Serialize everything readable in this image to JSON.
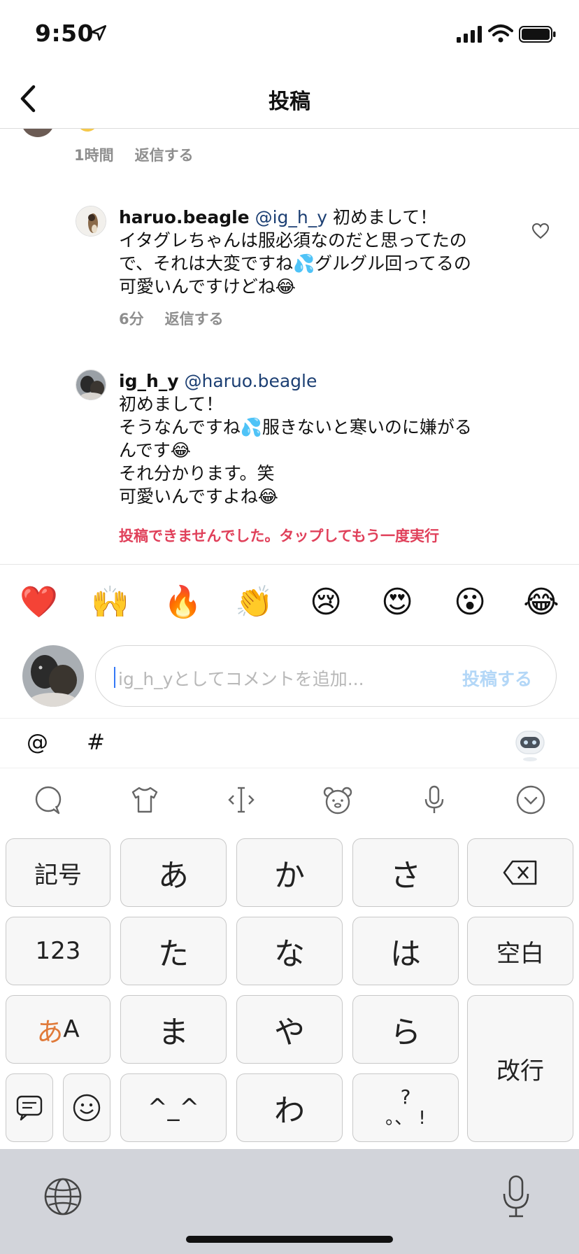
{
  "status_bar": {
    "time": "9:50"
  },
  "header": {
    "title": "投稿"
  },
  "top_comment_meta": {
    "time": "1時間",
    "reply": "返信する"
  },
  "comments": [
    {
      "user": "haruo.beagle",
      "mention": "@ig_h_y",
      "lines": [
        "初めまして！",
        "イタグレちゃんは服必須なのだと思ってたの",
        "で、それは大変ですね💦グルグル回ってるの",
        "可愛いんですけどね😂"
      ],
      "intro": " 初めまして！",
      "time": "6分",
      "reply": "返信する"
    },
    {
      "user": "ig_h_y",
      "mention": "@haruo.beagle",
      "lines": [
        "初めまして！",
        "そうなんですね💦服きないと寒いのに嫌がる",
        "んです😂",
        "それ分かります。笑",
        "可愛いんですよね😂"
      ],
      "error": "投稿できませんでした。タップしてもう一度実行"
    }
  ],
  "emoji_bar": [
    "❤️",
    "🙌",
    "🔥",
    "👏",
    "😢",
    "😍",
    "😮",
    "😂"
  ],
  "comment_input": {
    "placeholder": "ig_h_yとしてコメントを追加...",
    "post_label": "投稿する"
  },
  "mention_bar": {
    "at": "@",
    "hash": "#"
  },
  "keyboard": {
    "rows": [
      [
        "記号",
        "あ",
        "か",
        "さ",
        "⌫"
      ],
      [
        "123",
        "た",
        "な",
        "は",
        "空白"
      ],
      [
        "あA",
        "ま",
        "や",
        "ら",
        "改行"
      ],
      [
        "",
        "",
        "^_^",
        "わ",
        "。、?!"
      ]
    ],
    "kigou": "記号",
    "a": "あ",
    "ka": "か",
    "sa": "さ",
    "num": "123",
    "ta": "た",
    "na": "な",
    "ha": "は",
    "space": "空白",
    "mode_kana": "あ",
    "mode_alpha": "A",
    "ma": "ま",
    "ya": "や",
    "ra": "ら",
    "enter": "改行",
    "kaomoji": "^_^",
    "wa": "わ",
    "punct_top": "?",
    "punct_bottom": "。、 !"
  }
}
